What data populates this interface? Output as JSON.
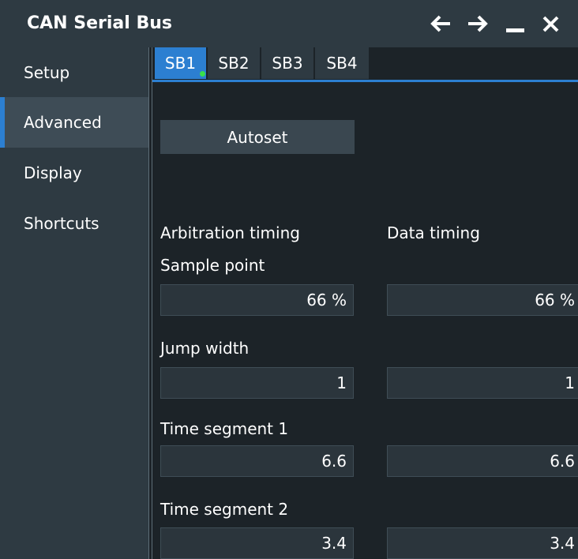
{
  "window": {
    "title": "CAN Serial Bus",
    "buttons": {
      "back_icon": "arrow-left",
      "forward_icon": "arrow-right",
      "minimize_icon": "minimize",
      "close_icon": "close"
    }
  },
  "sidebar": {
    "items": [
      {
        "label": "Setup",
        "active": false
      },
      {
        "label": "Advanced",
        "active": true
      },
      {
        "label": "Display",
        "active": false
      },
      {
        "label": "Shortcuts",
        "active": false
      }
    ]
  },
  "tabs": [
    {
      "label": "SB1",
      "active": true,
      "status_color": "#39e04a"
    },
    {
      "label": "SB2",
      "active": false
    },
    {
      "label": "SB3",
      "active": false
    },
    {
      "label": "SB4",
      "active": false
    }
  ],
  "autoset_label": "Autoset",
  "timing": {
    "arbitration_header": "Arbitration timing",
    "data_header": "Data timing",
    "rows": [
      {
        "label": "Sample point",
        "arbitration": "66 %",
        "data": "66 %"
      },
      {
        "label": "Jump width",
        "arbitration": "1",
        "data": "1"
      },
      {
        "label": "Time segment 1",
        "arbitration": "6.6",
        "data": "6.6"
      },
      {
        "label": "Time segment 2",
        "arbitration": "3.4",
        "data": "3.4"
      }
    ]
  },
  "colors": {
    "accent": "#2c7fd1",
    "panel": "#2e3a42",
    "background": "#1c2328",
    "status_ok": "#39e04a"
  }
}
